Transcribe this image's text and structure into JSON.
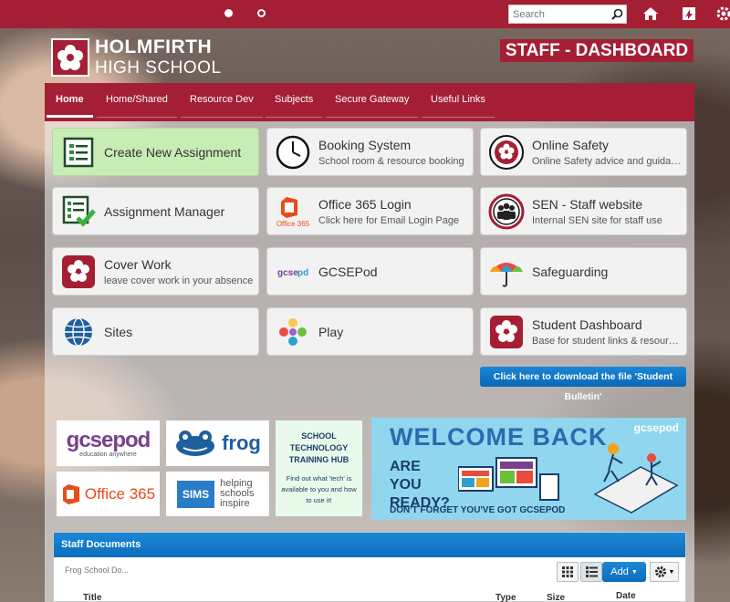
{
  "topbar": {
    "search_placeholder": "Search",
    "icons": [
      "search-icon",
      "home-icon",
      "frog-icon",
      "settings-icon"
    ]
  },
  "header": {
    "school_line1": "HOLMFIRTH",
    "school_line2": "HIGH SCHOOL",
    "dashboard_label": "STAFF - DASHBOARD"
  },
  "nav": {
    "items": [
      {
        "label": "Home",
        "active": true
      },
      {
        "label": "Home/Shared"
      },
      {
        "label": "Resource Dev"
      },
      {
        "label": "Subjects"
      },
      {
        "label": "Secure Gateway"
      },
      {
        "label": "Useful Links"
      }
    ]
  },
  "tiles": [
    {
      "title": "Create New Assignment",
      "subtitle": "",
      "icon": "checklist-icon"
    },
    {
      "title": "Booking System",
      "subtitle": "School room & resource booking",
      "icon": "clock-icon"
    },
    {
      "title": "Online Safety",
      "subtitle": "Online Safety advice and guidance",
      "icon": "school-crest-icon"
    },
    {
      "title": "Assignment Manager",
      "subtitle": "",
      "icon": "checklist-tick-icon"
    },
    {
      "title": "Office 365 Login",
      "subtitle": "Click here for Email Login Page",
      "icon": "office365-icon"
    },
    {
      "title": "SEN - Staff website",
      "subtitle": "Internal SEN site for staff use",
      "icon": "people-icon"
    },
    {
      "title": "Cover Work",
      "subtitle": "leave cover work in your absence",
      "icon": "school-crest-icon"
    },
    {
      "title": "GCSEPod",
      "subtitle": "",
      "icon": "gcsepod-icon"
    },
    {
      "title": "Safeguarding",
      "subtitle": "",
      "icon": "umbrella-icon"
    },
    {
      "title": "Sites",
      "subtitle": "",
      "icon": "globe-icon"
    },
    {
      "title": "Play",
      "subtitle": "",
      "icon": "play-icon"
    },
    {
      "title": "Student Dashboard",
      "subtitle": "Base for student links & resources",
      "icon": "school-crest-icon"
    }
  ],
  "download_button": "Click here to download the file 'Student Bulletin'",
  "banners": {
    "gcsepod": "gcsepod",
    "gcsepod_tag": "education anywhere",
    "frog": "frog",
    "office": "Office 365",
    "sims": "SIMS",
    "sims_tag": "helping schools inspire",
    "tech_hub_title": "SCHOOL TECHNOLOGY TRAINING HUB",
    "tech_hub_body": "Find out what 'tech' is available to you and how to use it!",
    "welcome_title": "WELCOME BACK",
    "welcome_q": "ARE YOU READY?",
    "welcome_foot": "DON'T FORGET YOU'VE GOT GCSEPOD",
    "welcome_logo": "gcsepod"
  },
  "docs": {
    "title": "Staff Documents",
    "breadcrumb": "Frog School Do...",
    "add_label": "Add",
    "columns": [
      "Title",
      "Type",
      "Size",
      "Date"
    ]
  },
  "colors": {
    "brand": "#a51f34",
    "blue": "#0c6cbc",
    "green_tile": "#c7ecb6"
  }
}
